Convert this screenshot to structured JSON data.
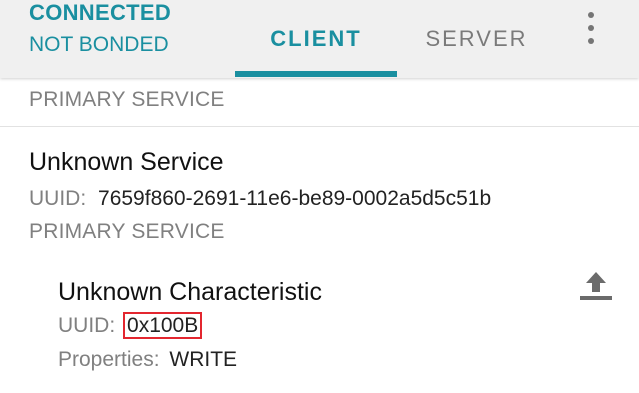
{
  "header": {
    "connection_status": "CONNECTED",
    "bond_status": "NOT BONDED",
    "tabs": [
      {
        "label": "CLIENT",
        "selected": true
      },
      {
        "label": "SERVER",
        "selected": false
      }
    ],
    "menu_icon": "more-vert-icon"
  },
  "services": [
    {
      "type_label": "PRIMARY SERVICE"
    },
    {
      "name": "Unknown Service",
      "uuid_label": "UUID:",
      "uuid": "7659f860-2691-11e6-be89-0002a5d5c51b",
      "type_label": "PRIMARY SERVICE",
      "characteristic": {
        "name": "Unknown Characteristic",
        "uuid_label": "UUID:",
        "uuid": "0x100B",
        "properties_label": "Properties:",
        "properties": "WRITE",
        "action_icon": "upload-icon"
      }
    }
  ],
  "colors": {
    "accent": "#1a8fa0",
    "highlight_box": "#e3262f",
    "header_bg": "#f0f0f0"
  }
}
